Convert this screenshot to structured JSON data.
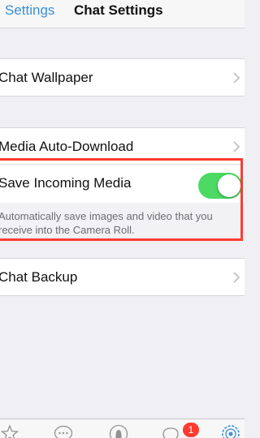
{
  "nav": {
    "back_label": "Settings",
    "title": "Chat Settings"
  },
  "rows": {
    "wallpaper": "Chat Wallpaper",
    "media_download": "Media Auto-Download",
    "save_media": "Save Incoming Media",
    "save_media_on": true,
    "save_media_description": "Automatically save images and video that you receive into the Camera Roll.",
    "backup": "Chat Backup"
  },
  "tabbar": {
    "tabs": [
      "star-icon",
      "chat-bubble-icon",
      "person-icon",
      "chats-icon",
      "settings-gear-icon"
    ],
    "chats_badge": "1"
  },
  "colors": {
    "accent": "#3a8fd6",
    "toggle_on": "#4cd964",
    "highlight": "#ff3b30",
    "badge": "#ff3b30"
  }
}
